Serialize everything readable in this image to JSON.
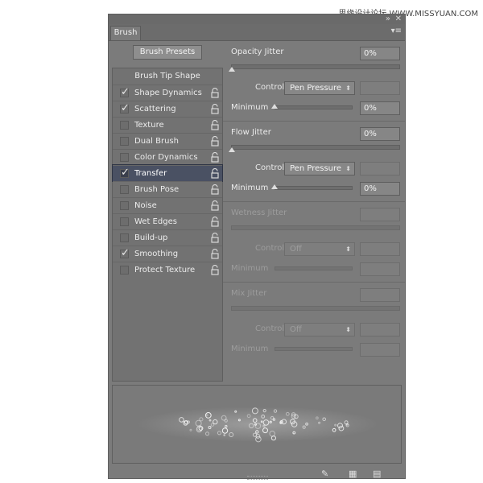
{
  "watermark": "思缘设计论坛 WWW.MISSYUAN.COM",
  "panel": {
    "tab_label": "Brush",
    "collapse_glyph": "»",
    "close_glyph": "✕",
    "menu_glyph": "▾≡",
    "presets_button": "Brush Presets",
    "tip_shape": "Brush Tip Shape"
  },
  "options": [
    {
      "label": "Shape Dynamics",
      "checked": true
    },
    {
      "label": "Scattering",
      "checked": true
    },
    {
      "label": "Texture",
      "checked": false
    },
    {
      "label": "Dual Brush",
      "checked": false
    },
    {
      "label": "Color Dynamics",
      "checked": false
    },
    {
      "label": "Transfer",
      "checked": true,
      "selected": true
    },
    {
      "label": "Brush Pose",
      "checked": false
    },
    {
      "label": "Noise",
      "checked": false
    },
    {
      "label": "Wet Edges",
      "checked": false
    },
    {
      "label": "Build-up",
      "checked": false
    },
    {
      "label": "Smoothing",
      "checked": true
    },
    {
      "label": "Protect Texture",
      "checked": false
    }
  ],
  "check_glyph": "✓",
  "arrow_glyph": "⬍",
  "sections": {
    "opacity": {
      "label": "Opacity Jitter",
      "value": "0%",
      "control_label": "Control:",
      "control_value": "Pen Pressure",
      "min_label": "Minimum",
      "min_value": "0%"
    },
    "flow": {
      "label": "Flow Jitter",
      "value": "0%",
      "control_label": "Control:",
      "control_value": "Pen Pressure",
      "min_label": "Minimum",
      "min_value": "0%"
    },
    "wetness": {
      "label": "Wetness Jitter",
      "control_label": "Control:",
      "control_value": "Off",
      "min_label": "Minimum"
    },
    "mix": {
      "label": "Mix Jitter",
      "control_label": "Control:",
      "control_value": "Off",
      "min_label": "Minimum"
    }
  },
  "icons": {
    "toggle_brush": "brush-toggle-icon",
    "grid": "grid-icon",
    "new_brush": "new-brush-icon"
  }
}
